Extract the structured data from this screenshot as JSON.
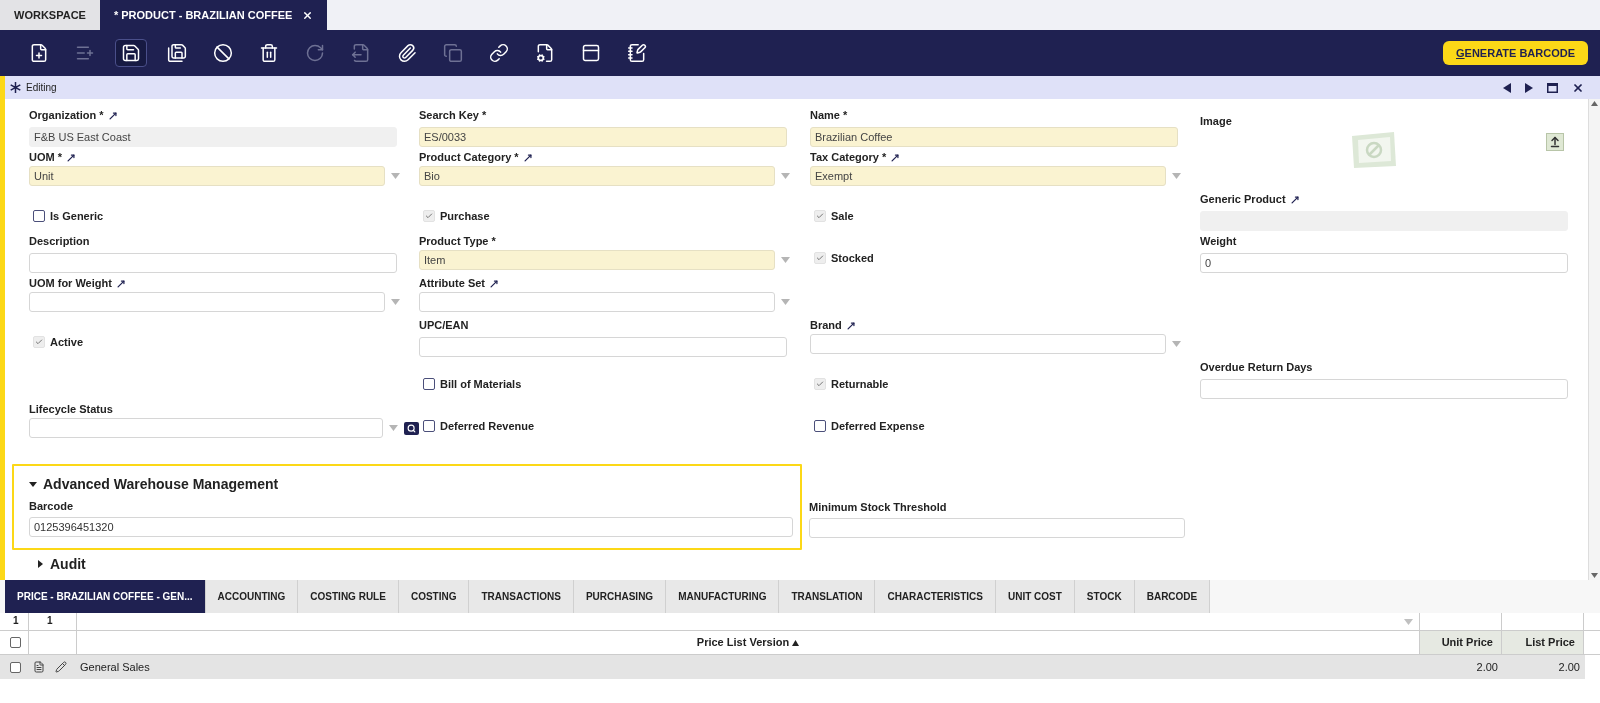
{
  "top_tabs": [
    {
      "label": "WORKSPACE",
      "selected": false,
      "closable": false
    },
    {
      "label": "* PRODUCT - BRAZILIAN COFFEE",
      "selected": true,
      "closable": true
    }
  ],
  "toolbar": {
    "buttons": [
      {
        "kind": "new",
        "disabled": false,
        "selected": false
      },
      {
        "kind": "new-row",
        "disabled": true,
        "selected": false
      },
      {
        "kind": "save",
        "disabled": false,
        "selected": true
      },
      {
        "kind": "save-new",
        "disabled": false,
        "selected": false
      },
      {
        "kind": "undo",
        "disabled": false,
        "selected": false
      },
      {
        "kind": "delete",
        "disabled": false,
        "selected": false
      },
      {
        "kind": "refresh",
        "disabled": true,
        "selected": false
      },
      {
        "kind": "export",
        "disabled": true,
        "selected": false
      },
      {
        "kind": "attach",
        "disabled": false,
        "selected": false
      },
      {
        "kind": "clone",
        "disabled": true,
        "selected": false
      },
      {
        "kind": "link",
        "disabled": false,
        "selected": false
      },
      {
        "kind": "audit",
        "disabled": false,
        "selected": false
      },
      {
        "kind": "grid",
        "disabled": false,
        "selected": false
      },
      {
        "kind": "notes",
        "disabled": false,
        "selected": false
      }
    ],
    "action": {
      "label": "GENERATE BARCODE",
      "underline_first": true
    }
  },
  "status": {
    "label": "Editing"
  },
  "form": {
    "fields": [
      {
        "kind": "text",
        "label": "Organization *",
        "link": true,
        "readonly": true,
        "required": false,
        "value": "F&B US East Coast"
      },
      {
        "kind": "text",
        "label": "Search Key *",
        "link": false,
        "readonly": false,
        "required": true,
        "value": "ES/0033"
      },
      {
        "kind": "text",
        "label": "Name *",
        "link": false,
        "readonly": false,
        "required": true,
        "value": "Brazilian Coffee"
      },
      {
        "kind": "image",
        "label": "Image"
      },
      {
        "kind": "select",
        "label": "UOM *",
        "link": true,
        "readonly": false,
        "required": true,
        "value": "Unit"
      },
      {
        "kind": "select",
        "label": "Product Category *",
        "link": true,
        "readonly": false,
        "required": true,
        "value": "Bio"
      },
      {
        "kind": "select",
        "label": "Tax Category *",
        "link": true,
        "readonly": false,
        "required": true,
        "value": "Exempt"
      },
      {
        "kind": "checkbox",
        "label": "Is Generic",
        "checked": false
      },
      {
        "kind": "checkbox",
        "label": "Purchase",
        "checked": true
      },
      {
        "kind": "checkbox",
        "label": "Sale",
        "checked": true
      },
      {
        "kind": "text",
        "label": "Generic Product",
        "link": true,
        "readonly": true,
        "required": false
      },
      {
        "kind": "text",
        "label": "Description",
        "link": false,
        "readonly": false,
        "required": false
      },
      {
        "kind": "select",
        "label": "Product Type *",
        "link": false,
        "readonly": false,
        "required": true,
        "value": "Item"
      },
      {
        "kind": "checkbox",
        "label": "Stocked",
        "checked": true
      },
      {
        "kind": "text",
        "label": "Weight",
        "link": false,
        "readonly": false,
        "required": false,
        "value": "0"
      },
      {
        "kind": "select",
        "label": "UOM for Weight",
        "link": true,
        "readonly": false,
        "required": false
      },
      {
        "kind": "select",
        "label": "Attribute Set",
        "link": true,
        "readonly": false,
        "required": false
      },
      {
        "kind": "blank"
      },
      {
        "kind": "blank"
      },
      {
        "kind": "checkbox",
        "label": "Active",
        "checked": true
      },
      {
        "kind": "text",
        "label": "UPC/EAN",
        "link": false,
        "readonly": false,
        "required": false
      },
      {
        "kind": "select",
        "label": "Brand",
        "link": true,
        "readonly": false,
        "required": false
      },
      {
        "kind": "blank"
      },
      {
        "kind": "blank"
      },
      {
        "kind": "checkbox",
        "label": "Bill of Materials",
        "checked": false
      },
      {
        "kind": "checkbox",
        "label": "Returnable",
        "checked": true
      },
      {
        "kind": "text",
        "label": "Overdue Return Days",
        "link": false,
        "readonly": false,
        "required": false
      },
      {
        "kind": "lookup",
        "label": "Lifecycle Status",
        "link": false,
        "readonly": false,
        "required": false
      },
      {
        "kind": "checkbox",
        "label": "Deferred Revenue",
        "checked": false
      },
      {
        "kind": "checkbox",
        "label": "Deferred Expense",
        "checked": false
      }
    ]
  },
  "section": {
    "title": "Advanced Warehouse Management",
    "expanded": true,
    "highlighted": true,
    "field": {
      "label": "Barcode",
      "value": "0125396451320"
    },
    "side_field": {
      "label": "Minimum Stock Threshold"
    }
  },
  "collapsed_section": {
    "title": "Audit",
    "expanded": false
  },
  "subtabs": [
    {
      "label": "PRICE - BRAZILIAN COFFEE - GEN...",
      "selected": true
    },
    {
      "label": "ACCOUNTING",
      "selected": false
    },
    {
      "label": "COSTING RULE",
      "selected": false
    },
    {
      "label": "COSTING",
      "selected": false
    },
    {
      "label": "TRANSACTIONS",
      "selected": false
    },
    {
      "label": "PURCHASING",
      "selected": false
    },
    {
      "label": "MANUFACTURING",
      "selected": false
    },
    {
      "label": "TRANSLATION",
      "selected": false
    },
    {
      "label": "CHARACTERISTICS",
      "selected": false
    },
    {
      "label": "UNIT COST",
      "selected": false
    },
    {
      "label": "STOCK",
      "selected": false
    },
    {
      "label": "BARCODE",
      "selected": false
    }
  ],
  "grid": {
    "counts": [
      "1",
      "1"
    ],
    "all_checked": false,
    "columns": [
      {
        "label": "Price List Version",
        "sorted": true
      },
      {
        "label": "Unit Price",
        "sorted": false
      },
      {
        "label": "List Price",
        "sorted": false
      }
    ],
    "rows": [
      {
        "checked": false,
        "cells": [
          "General Sales",
          "2.00",
          "2.00"
        ]
      }
    ]
  }
}
